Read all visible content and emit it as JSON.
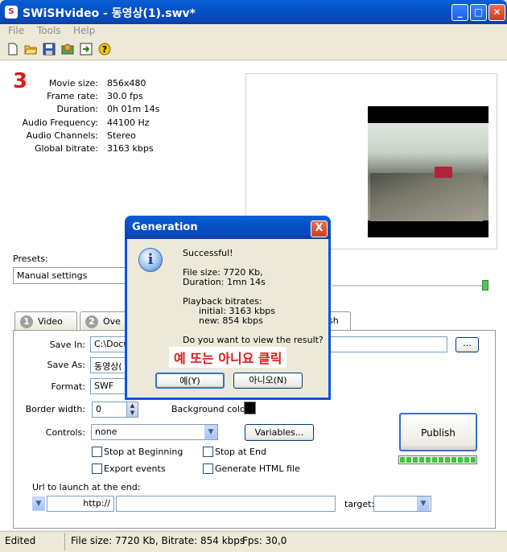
{
  "window": {
    "title": "SWiSHvideo - 동영상(1).swv*",
    "app_icon_letter": "S"
  },
  "menu": [
    "File",
    "Tools",
    "Help"
  ],
  "toolbar_icons": [
    "new-file-icon",
    "open-folder-icon",
    "save-icon",
    "settings-icon",
    "export-icon",
    "help-icon"
  ],
  "step_number": "3",
  "movie_info": [
    {
      "label": "Movie size:",
      "value": "856x480"
    },
    {
      "label": "Frame rate:",
      "value": "30.0  fps"
    },
    {
      "label": "Duration:",
      "value": "0h 01m 14s"
    },
    {
      "label": "Audio Frequency:",
      "value": "44100 Hz"
    },
    {
      "label": "Audio Channels:",
      "value": "Stereo"
    },
    {
      "label": "Global bitrate:",
      "value": "3163 kbps"
    }
  ],
  "preview_slider": {
    "position": 1.0
  },
  "presets": {
    "label": "Presets:",
    "value": "Manual settings"
  },
  "tabs": [
    {
      "num": "1",
      "label": "Video"
    },
    {
      "num": "2",
      "label": "Ove"
    },
    {
      "num": "",
      "label": "ish"
    }
  ],
  "form": {
    "save_in_label": "Save In:",
    "save_in_value": "C:\\Docu",
    "browse_label": "...",
    "save_as_label": "Save As:",
    "save_as_value": "동영상(",
    "format_label": "Format:",
    "format_value": "SWF",
    "border_label": "Border width:",
    "border_value": "0",
    "bgcolor_label": "Background color:",
    "bgcolor_value": "#000000",
    "controls_label": "Controls:",
    "controls_value": "none",
    "variables_label": "Variables...",
    "stop_begin_label": "Stop at Beginning",
    "stop_end_label": "Stop at End",
    "export_events_label": "Export events",
    "gen_html_label": "Generate HTML file",
    "url_label": "Url to launch at the end:",
    "url_prefix": "http://",
    "url_value": "",
    "target_label": "target:",
    "target_value": ""
  },
  "publish": {
    "label": "Publish",
    "progress": 1.0
  },
  "status": {
    "state": "Edited",
    "info": "File size: 7720 Kb, Bitrate: 854 kbps",
    "fps": "Fps: 30,0"
  },
  "dialog": {
    "title": "Generation",
    "close": "X",
    "info_glyph": "i",
    "success": "Successful!",
    "file_size": "File size: 7720 Kb,",
    "duration": "Duration: 1mn 14s",
    "bitrates_title": "Playback bitrates:",
    "initial": "initial: 3163 kbps",
    "new": "new: 854 kbps",
    "question": "Do you want to view the result?",
    "annotation": "예 또는 아니요 클릭",
    "yes_label": "예(Y)",
    "no_label": "아니오(N)"
  }
}
